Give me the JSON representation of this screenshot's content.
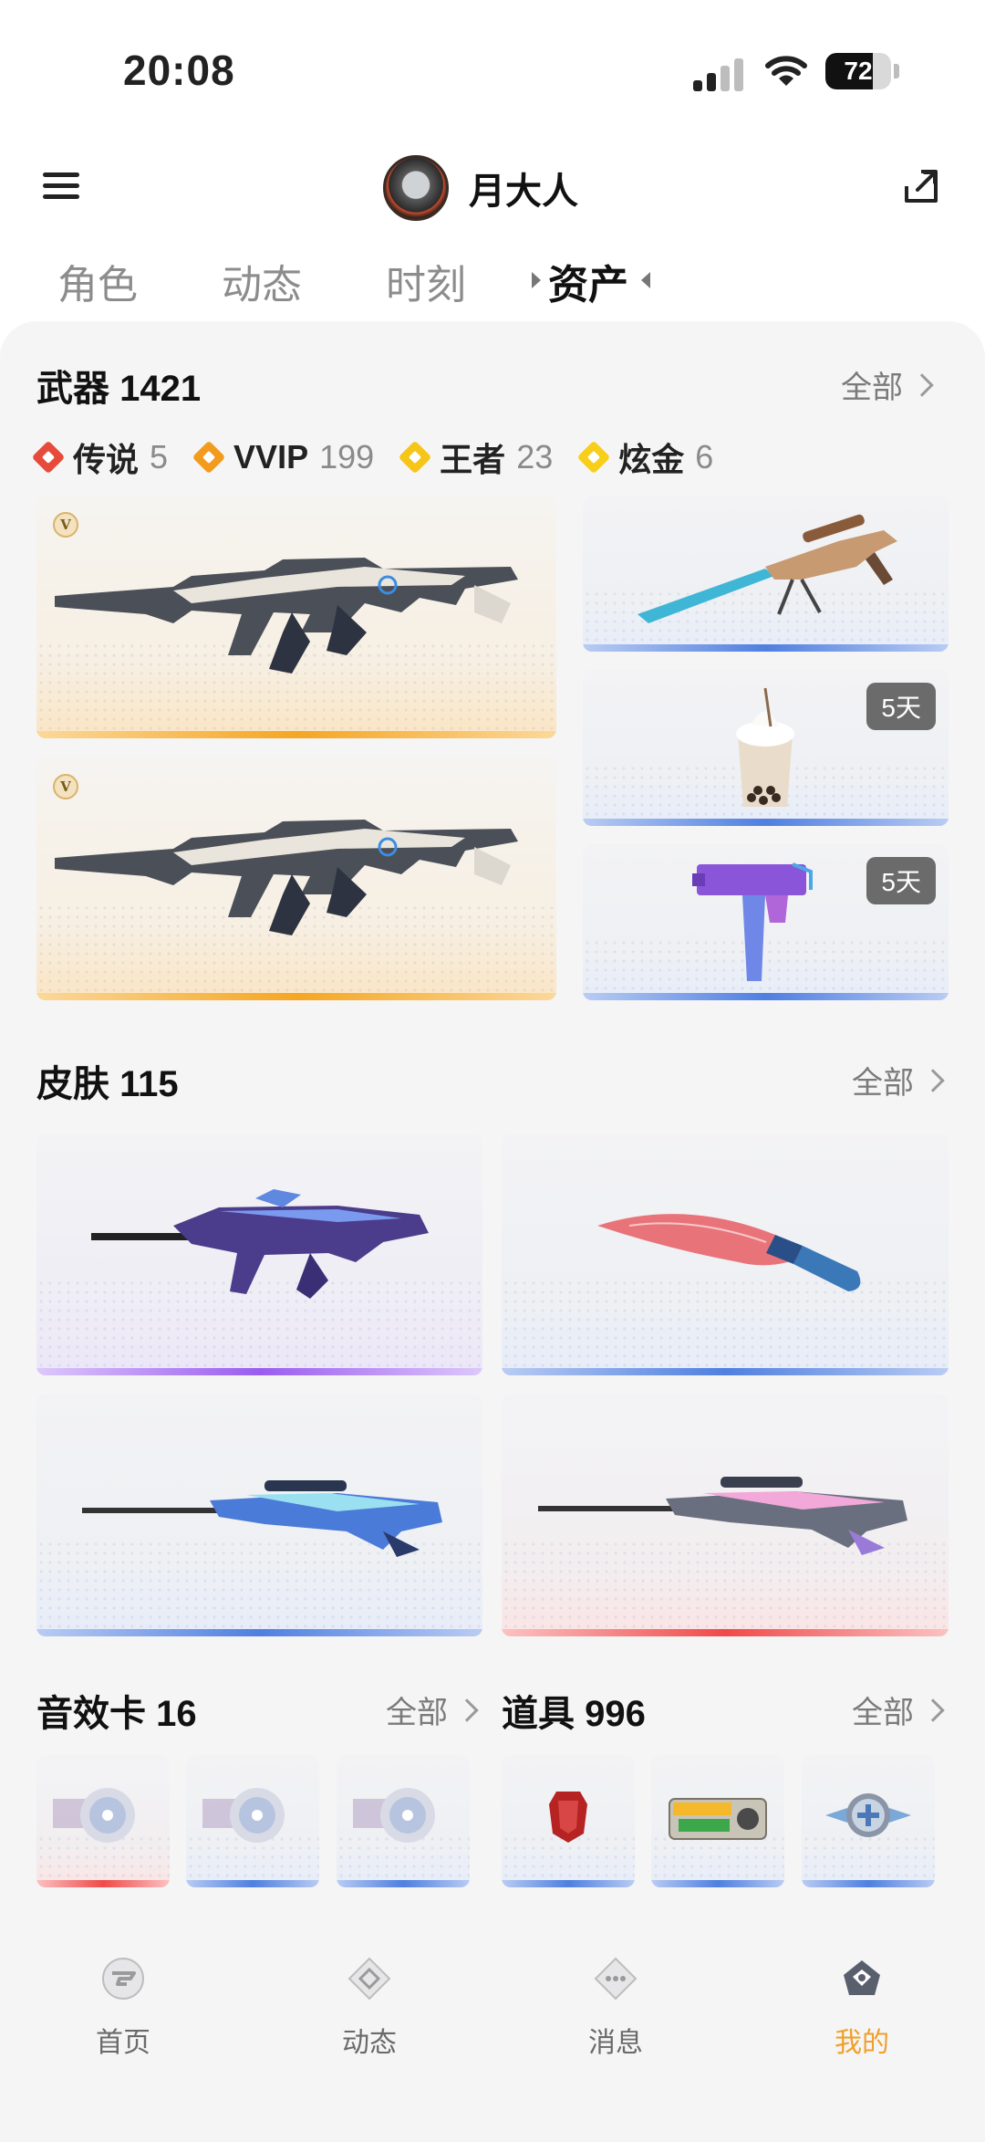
{
  "status_bar": {
    "time": "20:08",
    "battery": "72",
    "battery_level": 0.72
  },
  "header": {
    "username": "月大人"
  },
  "tabs": [
    {
      "label": "角色"
    },
    {
      "label": "动态"
    },
    {
      "label": "时刻"
    },
    {
      "label": "资产",
      "active": true
    }
  ],
  "weapons": {
    "title": "武器",
    "count": "1421",
    "more_label": "全部",
    "rarity": [
      {
        "name": "传说",
        "count": "5",
        "color": "#e64a3b"
      },
      {
        "name": "VVIP",
        "count": "199",
        "color": "#f29b1d"
      },
      {
        "name": "王者",
        "count": "23",
        "color": "#f5c518"
      },
      {
        "name": "炫金",
        "count": "6",
        "color": "#f7cf1a"
      }
    ],
    "items": [
      {
        "icon": "assault-rifle",
        "rarity": "gold",
        "badge": "V"
      },
      {
        "icon": "assault-rifle",
        "rarity": "gold",
        "badge": "V"
      },
      {
        "icon": "sniper-rifle",
        "rarity": "blue"
      },
      {
        "icon": "bubble-tea",
        "rarity": "blue",
        "days": "5天"
      },
      {
        "icon": "smg",
        "rarity": "blue",
        "days": "5天"
      }
    ]
  },
  "skins": {
    "title": "皮肤",
    "count": "115",
    "more_label": "全部",
    "items": [
      {
        "icon": "assault-rifle-skin",
        "rarity": "purple"
      },
      {
        "icon": "kukri-knife",
        "rarity": "blue"
      },
      {
        "icon": "sniper-rifle-skin",
        "rarity": "blue"
      },
      {
        "icon": "sniper-rifle-skin",
        "rarity": "red"
      }
    ]
  },
  "sound_cards": {
    "title": "音效卡",
    "count": "16",
    "more_label": "全部",
    "items": [
      {
        "icon": "cd-disc",
        "rarity": "red"
      },
      {
        "icon": "cd-disc",
        "rarity": "blue"
      },
      {
        "icon": "cd-disc",
        "rarity": "blue"
      }
    ]
  },
  "props": {
    "title": "道具",
    "count": "996",
    "more_label": "全部",
    "items": [
      {
        "icon": "red-card",
        "rarity": "blue"
      },
      {
        "icon": "coupon",
        "rarity": "blue"
      },
      {
        "icon": "medal",
        "rarity": "blue"
      }
    ]
  },
  "bottom_nav": [
    {
      "label": "首页",
      "icon": "home-icon"
    },
    {
      "label": "动态",
      "icon": "feed-icon"
    },
    {
      "label": "消息",
      "icon": "message-icon"
    },
    {
      "label": "我的",
      "icon": "profile-icon",
      "active": true
    }
  ],
  "colors": {
    "accent": "#f0a02a",
    "gold_bar": "#f5a623",
    "blue_bar": "#4f7fe0",
    "purple_bar": "#9a5cf0",
    "red_bar": "#f04a4a"
  }
}
